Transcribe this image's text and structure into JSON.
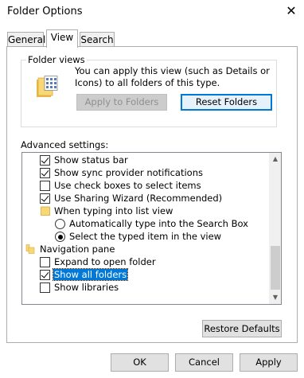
{
  "window": {
    "title": "Folder Options",
    "close_glyph": "✕"
  },
  "tabs": [
    {
      "label": "General",
      "active": false
    },
    {
      "label": "View",
      "active": true
    },
    {
      "label": "Search",
      "active": false
    }
  ],
  "folder_views": {
    "group_label": "Folder views",
    "description": "You can apply this view (such as Details or Icons) to all folders of this type.",
    "apply_button": "Apply to Folders",
    "reset_button": "Reset Folders"
  },
  "advanced": {
    "label": "Advanced settings:",
    "items": [
      {
        "kind": "checkbox",
        "label": "Show status bar",
        "checked": true
      },
      {
        "kind": "checkbox",
        "label": "Show sync provider notifications",
        "checked": true
      },
      {
        "kind": "checkbox",
        "label": "Use check boxes to select items",
        "checked": false
      },
      {
        "kind": "checkbox",
        "label": "Use Sharing Wizard (Recommended)",
        "checked": true
      },
      {
        "kind": "folder",
        "label": "When typing into list view"
      },
      {
        "kind": "radio",
        "label": "Automatically type into the Search Box",
        "selected": false
      },
      {
        "kind": "radio",
        "label": "Select the typed item in the view",
        "selected": true
      },
      {
        "kind": "navfolder",
        "label": "Navigation pane"
      },
      {
        "kind": "checkbox",
        "label": "Expand to open folder",
        "checked": false
      },
      {
        "kind": "checkbox",
        "label": "Show all folders",
        "checked": true,
        "highlighted": true
      },
      {
        "kind": "checkbox",
        "label": "Show libraries",
        "checked": false
      }
    ]
  },
  "restore_button": "Restore Defaults",
  "footer": {
    "ok": "OK",
    "cancel": "Cancel",
    "apply": "Apply"
  },
  "colors": {
    "accent": "#0078d7",
    "folder": "#f8d775"
  }
}
